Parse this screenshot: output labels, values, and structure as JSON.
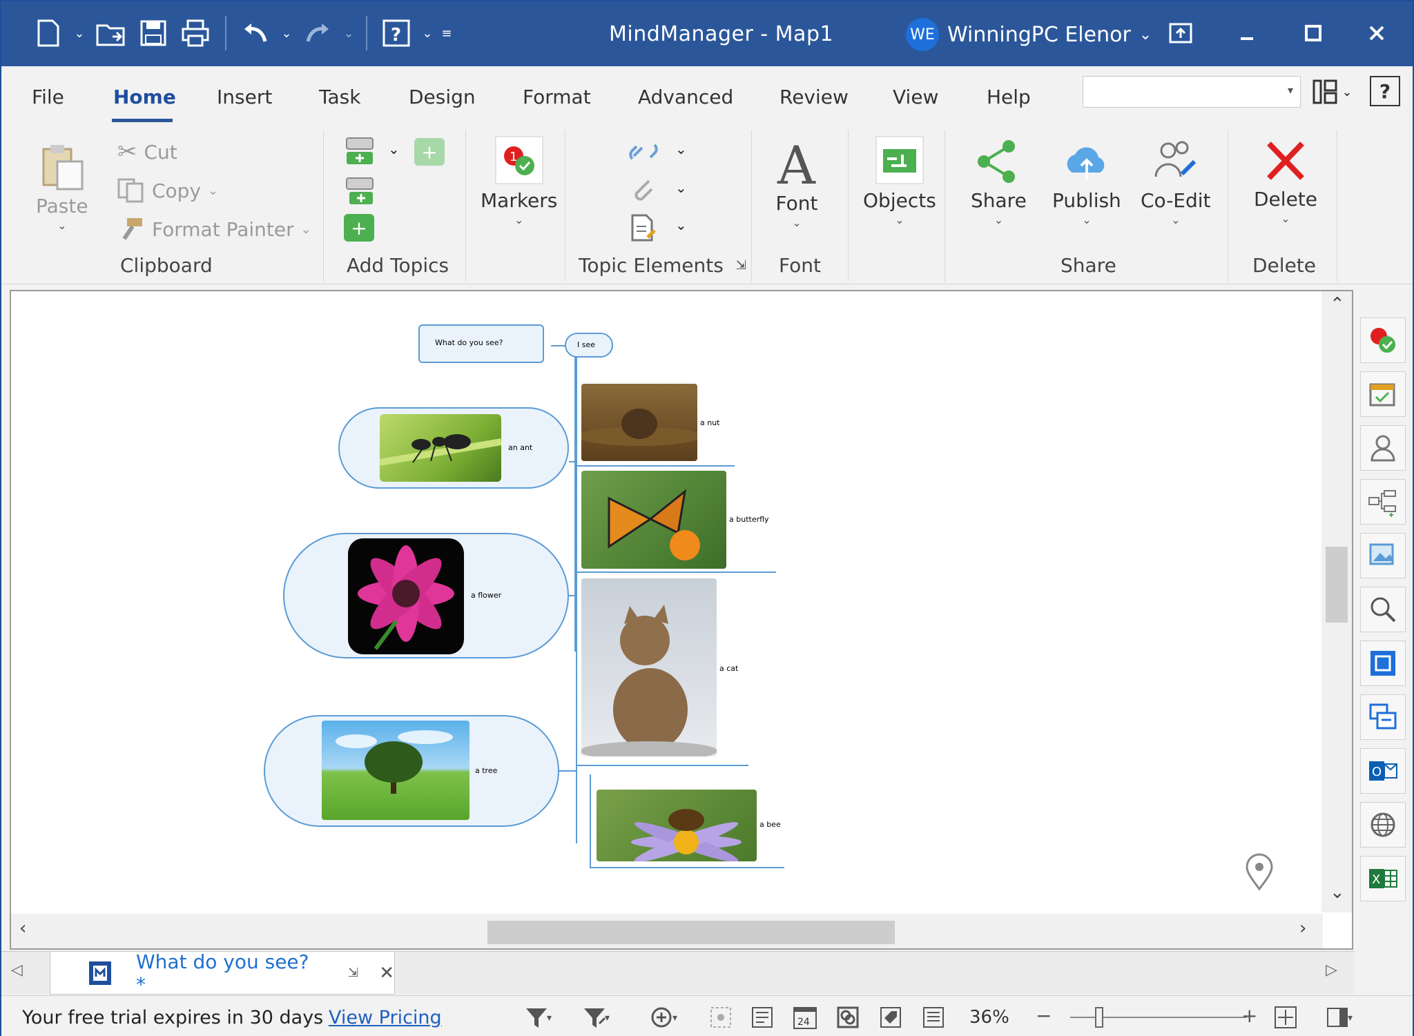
{
  "window": {
    "title": "MindManager - Map1",
    "user_initials": "WE",
    "user_name": "WinningPC Elenor"
  },
  "menu_tabs": [
    "File",
    "Home",
    "Insert",
    "Task",
    "Design",
    "Format",
    "Advanced",
    "Review",
    "View",
    "Help"
  ],
  "ribbon": {
    "clipboard": {
      "paste": "Paste",
      "cut": "Cut",
      "copy": "Copy",
      "format_painter": "Format Painter",
      "group": "Clipboard"
    },
    "add_topics": {
      "group": "Add Topics"
    },
    "markers": {
      "label": "Markers"
    },
    "topic_elements": {
      "group": "Topic Elements"
    },
    "font": {
      "label": "Font",
      "group": "Font"
    },
    "objects": {
      "label": "Objects"
    },
    "share": {
      "share": "Share",
      "publish": "Publish",
      "coedit": "Co-Edit",
      "group": "Share"
    },
    "delete": {
      "label": "Delete",
      "group": "Delete"
    }
  },
  "map": {
    "central_topic": "What do you see?",
    "main_topic": "I see",
    "left_topics": [
      "an ant",
      "a flower",
      "a tree"
    ],
    "right_topics": [
      "a nut",
      "a butterfly",
      "a cat",
      "a bee"
    ]
  },
  "document_tab": {
    "title": "What do you see? *"
  },
  "status": {
    "trial_message": "Your free trial expires in 30 days",
    "pricing_link": "View Pricing",
    "zoom": "36%",
    "calendar_day": "24"
  },
  "colors": {
    "titlebar": "#2b579a",
    "accent": "#1f4e9c",
    "topic_border": "#5b9bd5",
    "topic_fill": "#eaf3fb",
    "delete_red": "#e02020",
    "share_green": "#4caf50"
  }
}
